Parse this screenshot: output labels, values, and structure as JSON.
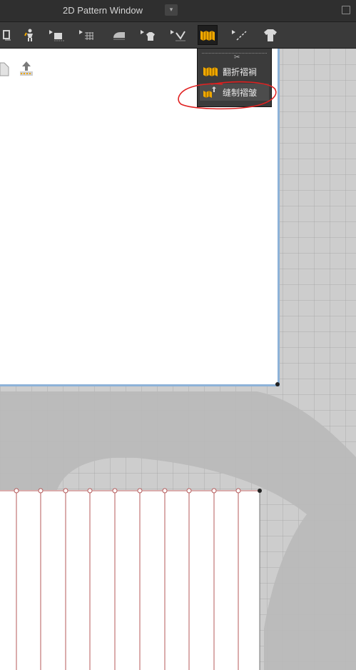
{
  "window": {
    "title": "2D Pattern Window",
    "title_dropdown_glyph": "▾"
  },
  "toolbar": {
    "icons": [
      "pattern-edit-icon",
      "avatar-pin-icon",
      "sew-segment-icon",
      "grid-sew-icon",
      "iron-icon",
      "garment-sew-icon",
      "needle-sew-icon",
      "pleat-fold-icon",
      "line-tool-icon",
      "tshirt-icon"
    ],
    "active_icon": "pleat-fold-icon"
  },
  "dropdown_menu": {
    "separator_glyph": "✂",
    "items": [
      {
        "label": "翻折褶裥",
        "icon": "pleat-fold-icon"
      },
      {
        "label": "缝制褶皱",
        "icon": "pleat-sew-icon"
      }
    ],
    "highlighted_index": 1
  },
  "colors": {
    "title_bar": "#2f2f2f",
    "toolbar": "#3a3a3a",
    "canvas": "#cdcdcd",
    "accent_orange": "#f0a800",
    "pattern_border": "#8db2d8",
    "pleat_line": "#b45a5a",
    "annotation": "#e02020"
  }
}
